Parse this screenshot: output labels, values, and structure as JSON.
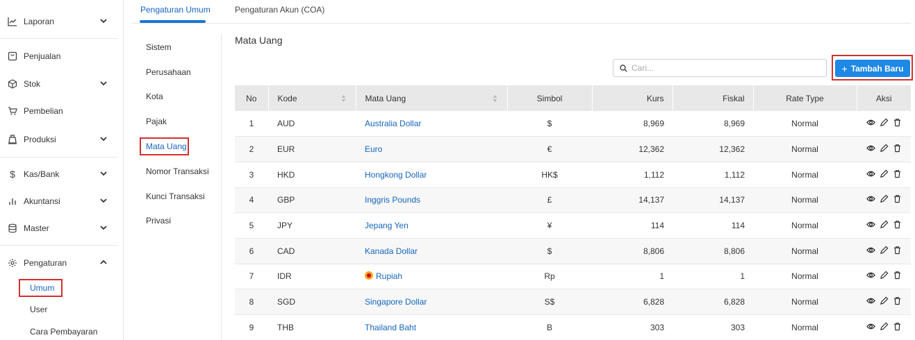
{
  "sidebar": {
    "items": [
      {
        "label": "Laporan",
        "icon": "line-chart-icon",
        "chevron": "down"
      },
      {
        "label": "Penjualan",
        "icon": "receipt-icon"
      },
      {
        "label": "Stok",
        "icon": "box-icon",
        "chevron": "down"
      },
      {
        "label": "Pembelian",
        "icon": "cart-icon"
      },
      {
        "label": "Produksi",
        "icon": "factory-icon",
        "chevron": "down"
      },
      {
        "label": "Kas/Bank",
        "icon": "dollar-icon",
        "chevron": "down"
      },
      {
        "label": "Akuntansi",
        "icon": "bar-chart-icon",
        "chevron": "down"
      },
      {
        "label": "Master",
        "icon": "database-icon",
        "chevron": "down"
      },
      {
        "label": "Pengaturan",
        "icon": "gear-icon",
        "chevron": "up"
      }
    ],
    "subitems": [
      "Umum",
      "User",
      "Cara Pembayaran"
    ],
    "active_subitem": "Umum"
  },
  "tabs": [
    "Pengaturan Umum",
    "Pengaturan Akun (COA)"
  ],
  "settings_menu": [
    "Sistem",
    "Perusahaan",
    "Kota",
    "Pajak",
    "Mata Uang",
    "Nomor Transaksi",
    "Kunci Transaksi",
    "Privasi"
  ],
  "active_setting": "Mata Uang",
  "page_title": "Mata Uang",
  "search": {
    "placeholder": "Cari..."
  },
  "add_button": {
    "label": "Tambah Baru"
  },
  "table": {
    "headers": [
      "No",
      "Kode",
      "Mata Uang",
      "Simbol",
      "Kurs",
      "Fiskal",
      "Rate Type",
      "Aksi"
    ],
    "rows": [
      {
        "no": "1",
        "kode": "AUD",
        "nama": "Australia Dollar",
        "simbol": "$",
        "kurs": "8,969",
        "fiskal": "8,969",
        "rate": "Normal"
      },
      {
        "no": "2",
        "kode": "EUR",
        "nama": "Euro",
        "simbol": "€",
        "kurs": "12,362",
        "fiskal": "12,362",
        "rate": "Normal"
      },
      {
        "no": "3",
        "kode": "HKD",
        "nama": "Hongkong Dollar",
        "simbol": "HK$",
        "kurs": "1,112",
        "fiskal": "1,112",
        "rate": "Normal"
      },
      {
        "no": "4",
        "kode": "GBP",
        "nama": "Inggris Pounds",
        "simbol": "£",
        "kurs": "14,137",
        "fiskal": "14,137",
        "rate": "Normal"
      },
      {
        "no": "5",
        "kode": "JPY",
        "nama": "Jepang Yen",
        "simbol": "¥",
        "kurs": "114",
        "fiskal": "114",
        "rate": "Normal"
      },
      {
        "no": "6",
        "kode": "CAD",
        "nama": "Kanada Dollar",
        "simbol": "$",
        "kurs": "8,806",
        "fiskal": "8,806",
        "rate": "Normal"
      },
      {
        "no": "7",
        "kode": "IDR",
        "nama": "Rupiah",
        "simbol": "Rp",
        "kurs": "1",
        "fiskal": "1",
        "rate": "Normal"
      },
      {
        "no": "8",
        "kode": "SGD",
        "nama": "Singapore Dollar",
        "simbol": "S$",
        "kurs": "6,828",
        "fiskal": "6,828",
        "rate": "Normal"
      },
      {
        "no": "9",
        "kode": "THB",
        "nama": "Thailand Baht",
        "simbol": "B",
        "kurs": "303",
        "fiskal": "303",
        "rate": "Normal"
      }
    ]
  },
  "colors": {
    "accent": "#1e88e5",
    "link": "#1565c0",
    "highlight": "#d32f2f",
    "header_bg": "#e8e8e8"
  }
}
